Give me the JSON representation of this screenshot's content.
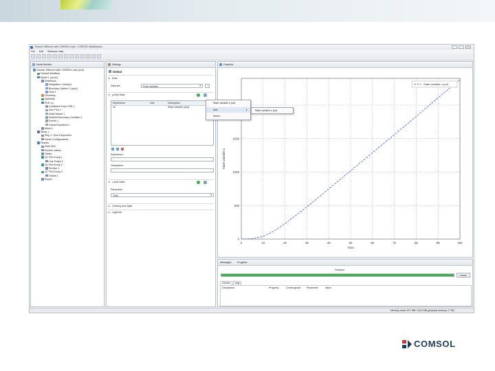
{
  "app": {
    "title": "Tutorial: Diffusion with COMSOL.mph - COMSOL Multiphysics",
    "menu": [
      "File",
      "Edit",
      "Windows",
      "Help"
    ]
  },
  "model_builder": {
    "tab_label": "Model Builder",
    "tree": [
      {
        "level": 0,
        "label": "Tutorial: Diffusion with COMSOL.mph (root)",
        "icon": "model-root-icon",
        "color": "#6b8bb8"
      },
      {
        "level": 1,
        "label": "Global Definitions",
        "icon": "globe-icon",
        "color": "#5a9a58"
      },
      {
        "level": 1,
        "label": "Model 1 (mod1)",
        "icon": "model-icon",
        "color": "#4a7fb8"
      },
      {
        "level": 2,
        "label": "Definitions",
        "icon": "definitions-icon",
        "color": "#8c7fb0"
      },
      {
        "level": 3,
        "label": "Integration 1 (intop1)",
        "icon": "integration-icon",
        "color": "#7a9ed6"
      },
      {
        "level": 3,
        "label": "Boundary System 1 (sys1)",
        "icon": "coordinate-system-icon",
        "color": "#7a9ed6"
      },
      {
        "level": 3,
        "label": "View 1",
        "icon": "view-icon",
        "color": "#7a9ed6"
      },
      {
        "level": 2,
        "label": "Geometry",
        "icon": "geometry-icon",
        "color": "#c98a3a"
      },
      {
        "level": 2,
        "label": "Materials",
        "icon": "materials-icon",
        "color": "#3e9c6a"
      },
      {
        "level": 2,
        "label": "PDE (c)",
        "icon": "pde-icon",
        "color": "#4878b0"
      },
      {
        "level": 3,
        "label": "Coefficient Form PDE 1",
        "icon": "pde-node-icon",
        "color": "#8ca0b8"
      },
      {
        "level": 3,
        "label": "Zero Flux 1",
        "icon": "boundary-icon",
        "color": "#8ca0b8"
      },
      {
        "level": 3,
        "label": "Initial Values 1",
        "icon": "initial-values-icon",
        "color": "#8ca0b8"
      },
      {
        "level": 3,
        "label": "Dirichlet Boundary Condition 1",
        "icon": "boundary-icon",
        "color": "#8ca0b8"
      },
      {
        "level": 3,
        "label": "Events 1",
        "icon": "events-icon",
        "color": "#8ca0b8"
      },
      {
        "level": 3,
        "label": "Global Equations 1",
        "icon": "global-equations-icon",
        "color": "#8ca0b8"
      },
      {
        "level": 2,
        "label": "Mesh 1",
        "icon": "mesh-icon",
        "color": "#7d8ea0"
      },
      {
        "level": 1,
        "label": "Study 1",
        "icon": "study-icon",
        "color": "#5a6fa0"
      },
      {
        "level": 2,
        "label": "Step 1: Time Dependent",
        "icon": "study-step-icon",
        "color": "#8a8a8a"
      },
      {
        "level": 2,
        "label": "Solver Configurations",
        "icon": "solver-icon",
        "color": "#8a8a8a"
      },
      {
        "level": 1,
        "label": "Results",
        "icon": "results-icon",
        "color": "#4a7fb8"
      },
      {
        "level": 2,
        "label": "Data Sets",
        "icon": "datasets-icon",
        "color": "#6d8fb5"
      },
      {
        "level": 2,
        "label": "Derived Values",
        "icon": "derived-values-icon",
        "color": "#6d8fb5"
      },
      {
        "level": 2,
        "label": "Tables",
        "icon": "tables-icon",
        "color": "#6d8fb5"
      },
      {
        "level": 2,
        "label": "1D Plot Group 1",
        "icon": "plot-group-icon",
        "color": "#3c9a8c"
      },
      {
        "level": 3,
        "label": "Line Graph 1",
        "icon": "line-graph-icon",
        "color": "#6d8fb5"
      },
      {
        "level": 2,
        "label": "2D Plot Group 2",
        "icon": "plot-group-icon",
        "color": "#3c9a8c"
      },
      {
        "level": 3,
        "label": "Surface 1",
        "icon": "surface-icon",
        "color": "#6d8fb5"
      },
      {
        "level": 2,
        "label": "1D Plot Group 3",
        "icon": "plot-group-icon",
        "color": "#3c9a8c"
      },
      {
        "level": 3,
        "label": "Global 1",
        "icon": "global-plot-icon",
        "color": "#6d8fb5"
      },
      {
        "level": 2,
        "label": "Report",
        "icon": "report-icon",
        "color": "#6d8fb5"
      }
    ]
  },
  "settings": {
    "tab_label": "Settings",
    "node_title": "Global",
    "data_section": "Data",
    "data_set_label": "Data set:",
    "data_set_value": "From solution",
    "y_axis_section": "y-Axis Data",
    "table_headers": [
      "Expression",
      "Unit",
      "Description"
    ],
    "table_row": [
      "ud",
      "",
      "State variable u(ud)"
    ],
    "expression_label": "Expression:",
    "description_label": "Description:",
    "x_axis_section": "x-Axis Data",
    "parameter_label": "Parameter:",
    "parameter_value": "Time",
    "coloring_section": "Coloring and Style",
    "legends_section": "Legends"
  },
  "context_menu": {
    "items": [
      "State variable u (ud)",
      "Add",
      "Select"
    ],
    "submenu_item": "State variable u (ud)"
  },
  "graphics": {
    "tab_label": "Graphics",
    "legend": "State variable u (ud)",
    "accent_color": "#3a5bd9"
  },
  "chart_data": {
    "type": "line",
    "xlabel": "Time",
    "ylabel": "State variable u",
    "xlim": [
      0,
      100
    ],
    "ylim": [
      0,
      2400
    ],
    "x_ticks": [
      0,
      10,
      20,
      30,
      40,
      50,
      60,
      70,
      80,
      90,
      100
    ],
    "y_ticks": [
      0,
      500,
      1000,
      1500,
      2000
    ],
    "grid": true,
    "legend_position": "top-right",
    "series": [
      {
        "name": "State variable u (ud)",
        "x": [
          0,
          5,
          10,
          15,
          20,
          30,
          40,
          50,
          60,
          70,
          80,
          90,
          100
        ],
        "y": [
          0,
          5,
          40,
          120,
          230,
          480,
          750,
          1020,
          1290,
          1560,
          1830,
          2110,
          2380
        ]
      }
    ]
  },
  "messages": {
    "tabs": [
      "Messages",
      "Progress"
    ],
    "status": "Finished",
    "progress_fraction": 1.0,
    "cancel_label": "Cancel",
    "sub_tabs": [
      "Solvers",
      "Log"
    ],
    "columns": [
      "Description",
      "Progress",
      "Convergence",
      "Parameter",
      "Value"
    ]
  },
  "status_bar": {
    "text": "Memory used: 877 MB / 1110 MB (physical memory: 2 TB)"
  },
  "brand": {
    "logo_text": "COMSOL",
    "logo_color": "#1f3a5f",
    "logo_mark_color": "#d4322c"
  }
}
